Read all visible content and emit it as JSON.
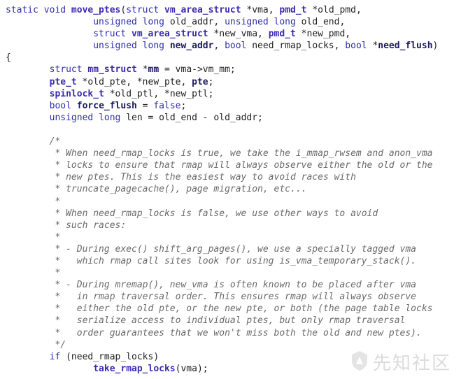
{
  "code": {
    "lines": [
      [
        [
          "kw",
          "static void "
        ],
        [
          "fn",
          "move_ptes"
        ],
        [
          "pl",
          "("
        ],
        [
          "kw",
          "struct "
        ],
        [
          "ty",
          "vm_area_struct"
        ],
        [
          "pl",
          " *vma, "
        ],
        [
          "ty",
          "pmd_t"
        ],
        [
          "pl",
          " *old_pmd,"
        ]
      ],
      [
        [
          "pl",
          "                "
        ],
        [
          "kw",
          "unsigned long "
        ],
        [
          "pl",
          "old_addr, "
        ],
        [
          "kw",
          "unsigned long "
        ],
        [
          "pl",
          "old_end,"
        ]
      ],
      [
        [
          "pl",
          "                "
        ],
        [
          "kw",
          "struct "
        ],
        [
          "ty",
          "vm_area_struct"
        ],
        [
          "pl",
          " *new_vma, "
        ],
        [
          "ty",
          "pmd_t"
        ],
        [
          "pl",
          " *new_pmd,"
        ]
      ],
      [
        [
          "pl",
          "                "
        ],
        [
          "kw",
          "unsigned long "
        ],
        [
          "var",
          "new_addr"
        ],
        [
          "pl",
          ", "
        ],
        [
          "kw",
          "bool "
        ],
        [
          "pl",
          "need_rmap_locks, "
        ],
        [
          "kw",
          "bool "
        ],
        [
          "pl",
          "*"
        ],
        [
          "var",
          "need_flush"
        ],
        [
          "pl",
          ")"
        ]
      ],
      [
        [
          "pl",
          "{"
        ]
      ],
      [
        [
          "pl",
          "        "
        ],
        [
          "kw",
          "struct "
        ],
        [
          "ty",
          "mm_struct"
        ],
        [
          "pl",
          " *"
        ],
        [
          "var",
          "mm"
        ],
        [
          "pl",
          " = vma->vm_mm;"
        ]
      ],
      [
        [
          "pl",
          "        "
        ],
        [
          "ty",
          "pte_t"
        ],
        [
          "pl",
          " *old_pte, *new_pte, "
        ],
        [
          "var",
          "pte"
        ],
        [
          "pl",
          ";"
        ]
      ],
      [
        [
          "pl",
          "        "
        ],
        [
          "ty",
          "spinlock_t"
        ],
        [
          "pl",
          " *old_ptl, *new_ptl;"
        ]
      ],
      [
        [
          "pl",
          "        "
        ],
        [
          "kw",
          "bool "
        ],
        [
          "var",
          "force_flush"
        ],
        [
          "pl",
          " = "
        ],
        [
          "kw",
          "false"
        ],
        [
          "pl",
          ";"
        ]
      ],
      [
        [
          "pl",
          "        "
        ],
        [
          "kw",
          "unsigned long "
        ],
        [
          "pl",
          "len = old_end - old_addr;"
        ]
      ],
      [
        [
          "pl",
          ""
        ]
      ],
      [
        [
          "cm",
          "        /*"
        ]
      ],
      [
        [
          "cm",
          "         * When need_rmap_locks is true, we take the i_mmap_rwsem and anon_vma"
        ]
      ],
      [
        [
          "cm",
          "         * locks to ensure that rmap will always observe either the old or the"
        ]
      ],
      [
        [
          "cm",
          "         * new ptes. This is the easiest way to avoid races with"
        ]
      ],
      [
        [
          "cm",
          "         * truncate_pagecache(), page migration, etc..."
        ]
      ],
      [
        [
          "cm",
          "         *"
        ]
      ],
      [
        [
          "cm",
          "         * When need_rmap_locks is false, we use other ways to avoid"
        ]
      ],
      [
        [
          "cm",
          "         * such races:"
        ]
      ],
      [
        [
          "cm",
          "         *"
        ]
      ],
      [
        [
          "cm",
          "         * - During exec() shift_arg_pages(), we use a specially tagged vma"
        ]
      ],
      [
        [
          "cm",
          "         *   which rmap call sites look for using is_vma_temporary_stack()."
        ]
      ],
      [
        [
          "cm",
          "         *"
        ]
      ],
      [
        [
          "cm",
          "         * - During mremap(), new_vma is often known to be placed after vma"
        ]
      ],
      [
        [
          "cm",
          "         *   in rmap traversal order. This ensures rmap will always observe"
        ]
      ],
      [
        [
          "cm",
          "         *   either the old pte, or the new pte, or both (the page table locks"
        ]
      ],
      [
        [
          "cm",
          "         *   serialize access to individual ptes, but only rmap traversal"
        ]
      ],
      [
        [
          "cm",
          "         *   order guarantees that we won't miss both the old and new ptes)."
        ]
      ],
      [
        [
          "cm",
          "         */"
        ]
      ],
      [
        [
          "pl",
          "        "
        ],
        [
          "kw",
          "if "
        ],
        [
          "pl",
          "(need_rmap_locks)"
        ]
      ],
      [
        [
          "pl",
          "                "
        ],
        [
          "fn",
          "take_rmap_locks"
        ],
        [
          "pl",
          "(vma);"
        ]
      ]
    ]
  },
  "watermark": {
    "text": "先知社区",
    "icon": "shield-logo-icon"
  }
}
